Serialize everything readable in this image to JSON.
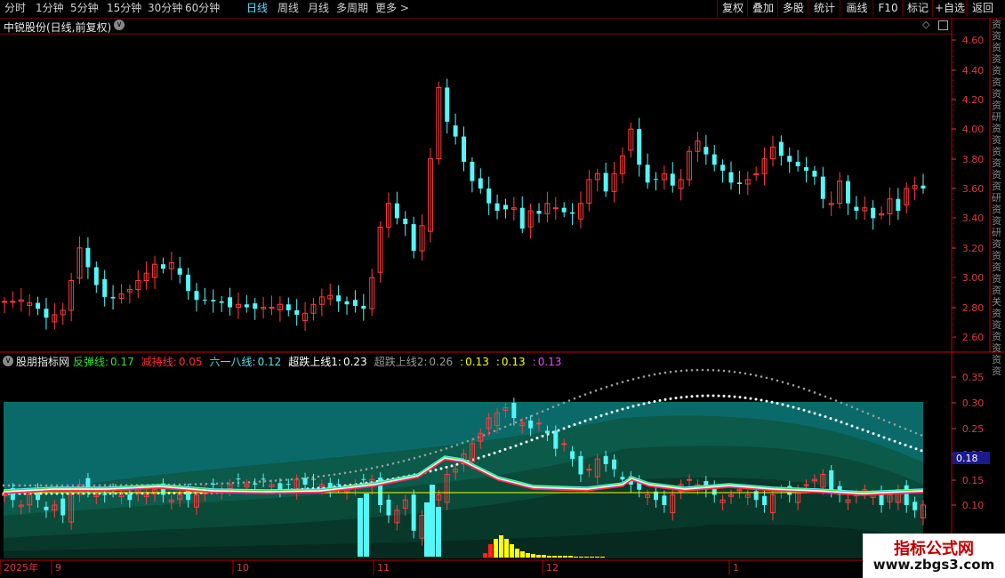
{
  "toolbar": {
    "periods": [
      "分时",
      "1分钟",
      "5分钟",
      "15分钟",
      "30分钟",
      "60分钟",
      "日线",
      "周线",
      "月线",
      "多周期",
      "更多 >"
    ],
    "active_period": "日线",
    "right_buttons": [
      "复权",
      "叠加",
      "多股",
      "统计",
      "画线",
      "F10",
      "标记",
      "+自选",
      "返回"
    ]
  },
  "main_chart": {
    "title": "中锐股份(日线,前复权)",
    "y_ticks": [
      "4.60",
      "4.40",
      "4.20",
      "4.00",
      "3.80",
      "3.60",
      "3.40",
      "3.20",
      "3.00",
      "2.80",
      "2.60"
    ]
  },
  "indicator": {
    "name": "股朋指标网",
    "items": [
      {
        "label": "反弹线:",
        "value": "0.17",
        "color": "#35e035"
      },
      {
        "label": "减持线:",
        "value": "0.05",
        "color": "#ff3030"
      },
      {
        "label": "六一八线:",
        "value": "0.12",
        "color": "#4fe2e2"
      },
      {
        "label": "超跌上线1:",
        "value": "0.23",
        "color": "#ffffff"
      },
      {
        "label": "超跌上线2:",
        "value": "0.26",
        "color": "#9a9a9a"
      },
      {
        "label": ":",
        "value": "0.13",
        "color": "#ffff00"
      },
      {
        "label": ":",
        "value": "0.13",
        "color": "#ffff00"
      },
      {
        "label": ":",
        "value": "0.13",
        "color": "#ff44ff"
      }
    ],
    "y_ticks": [
      "0.35",
      "0.30",
      "0.25",
      "0.20",
      "0.15",
      "0.10"
    ],
    "current_value": "0.18"
  },
  "date_axis": {
    "labels": [
      "2025年",
      "9",
      "10",
      "11",
      "12",
      "1"
    ]
  },
  "right_strip_text": "资资资资资资资资研资资资资资资研资资研资资资资资关资资资资资资",
  "watermark": {
    "line1": "指标公式网",
    "line2": "www.zbgs3.com"
  },
  "colors": {
    "up": "#ff3c3c",
    "down": "#54f7f7",
    "grid_red": "#8b0000",
    "tick_text": "#d83c3c",
    "teal_band": "#0a6a6a"
  }
}
